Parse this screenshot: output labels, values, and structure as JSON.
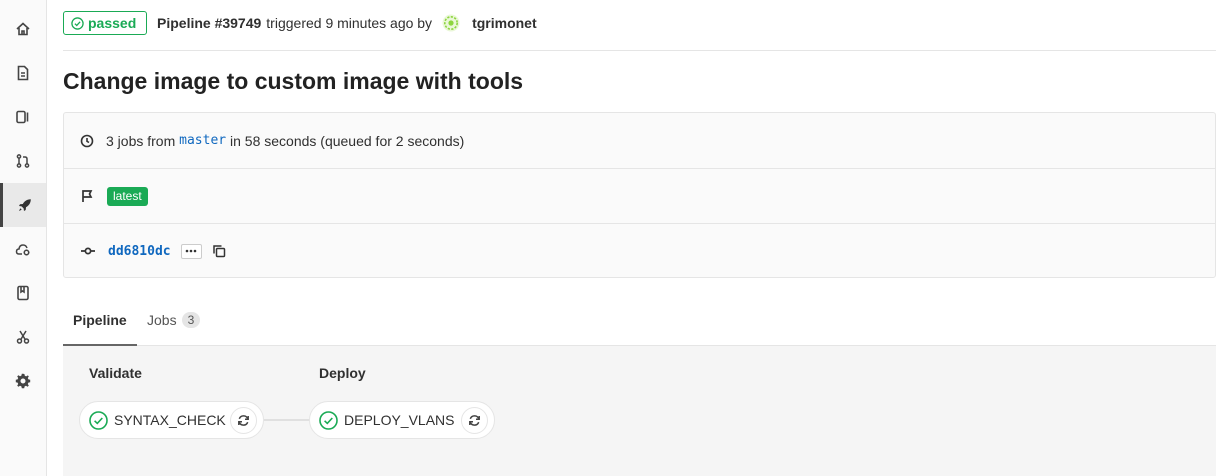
{
  "header": {
    "status": "passed",
    "pipeline_label": "Pipeline #39749",
    "triggered_text": "triggered 9 minutes ago by",
    "author": "tgrimonet"
  },
  "title": "Change image to custom image with tools",
  "info": {
    "jobs_prefix": "3 jobs from",
    "branch": "master",
    "jobs_suffix": "in 58 seconds (queued for 2 seconds)",
    "latest_badge": "latest",
    "commit_sha": "dd6810dc"
  },
  "tabs": [
    {
      "label": "Pipeline"
    },
    {
      "label": "Jobs",
      "count": "3"
    }
  ],
  "stages": [
    {
      "name": "Validate",
      "job": "SYNTAX_CHECK",
      "status": "success"
    },
    {
      "name": "Deploy",
      "job": "DEPLOY_VLANS",
      "status": "success"
    }
  ],
  "sidebar": [
    {
      "icon": "home-icon"
    },
    {
      "icon": "file-icon"
    },
    {
      "icon": "issues-icon"
    },
    {
      "icon": "merge-request-icon"
    },
    {
      "icon": "rocket-icon",
      "active": true
    },
    {
      "icon": "operations-icon"
    },
    {
      "icon": "book-icon"
    },
    {
      "icon": "snippet-icon"
    },
    {
      "icon": "settings-icon"
    }
  ],
  "colors": {
    "success": "#1aaa55",
    "link": "#1068bf",
    "border": "#e5e5e5"
  }
}
